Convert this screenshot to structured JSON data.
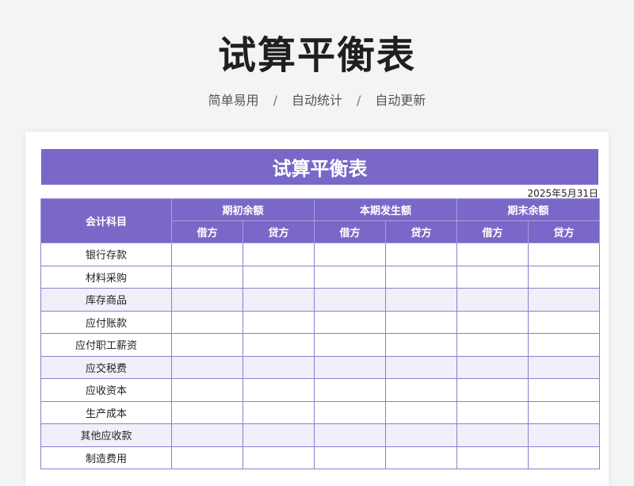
{
  "page": {
    "title": "试算平衡表",
    "tagline": [
      "简单易用",
      "自动统计",
      "自动更新"
    ],
    "separator": "/"
  },
  "sheet": {
    "title": "试算平衡表",
    "date": "2025年5月31日",
    "header": {
      "account_col": "会计科目",
      "groups": [
        "期初余额",
        "本期发生额",
        "期末余额"
      ],
      "debit": "借方",
      "credit": "贷方"
    },
    "rows": [
      "银行存款",
      "材料采购",
      "库存商品",
      "应付账款",
      "应付职工薪资",
      "应交税费",
      "应收资本",
      "生产成本",
      "其他应收款",
      "制造费用"
    ]
  },
  "colors": {
    "accent": "#7a67c7",
    "stripe": "#f0effa",
    "background": "#f3f4f6"
  }
}
